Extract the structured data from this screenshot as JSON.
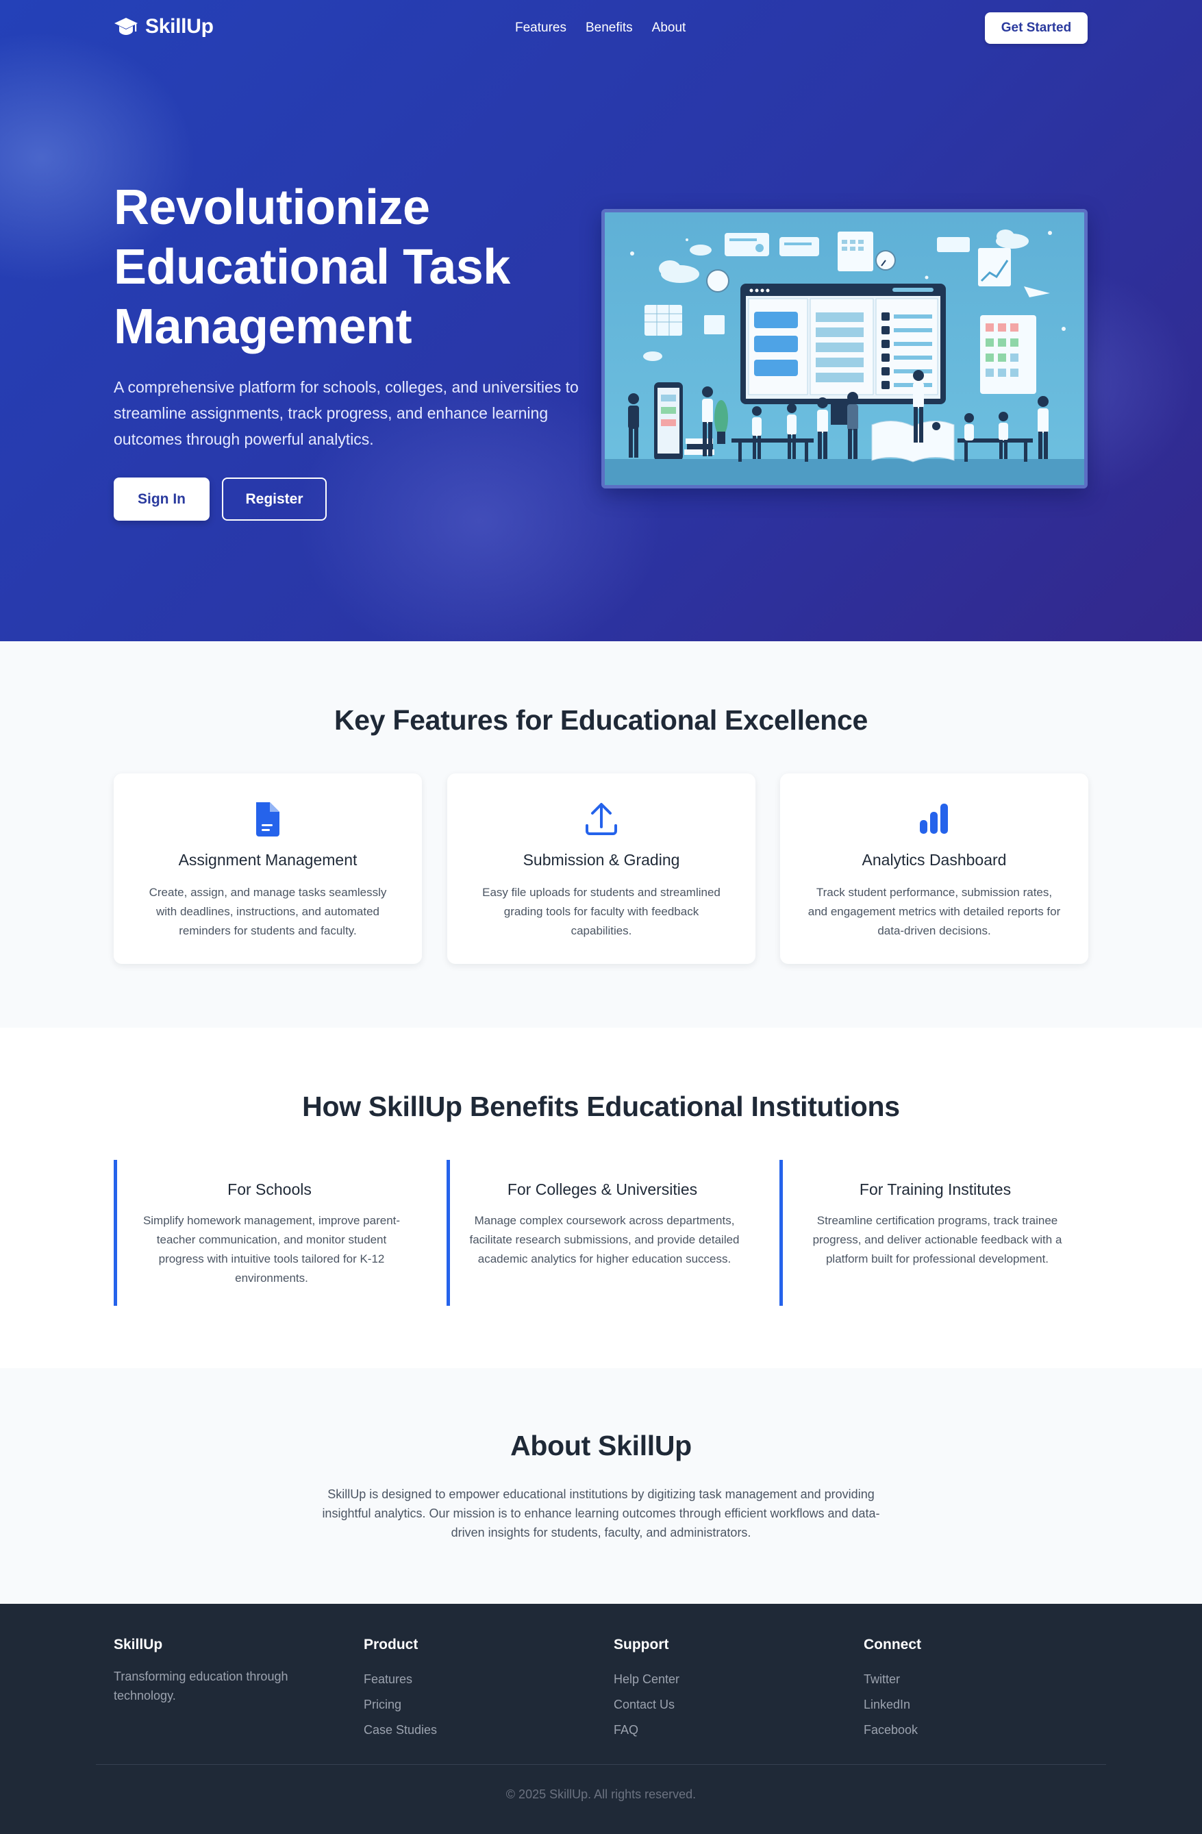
{
  "brand": {
    "name": "SkillUp",
    "accent": "#2563eb",
    "hero_gradient_start": "#2441b8",
    "hero_gradient_end": "#33288c",
    "logo_icon": "graduation-cap-icon"
  },
  "nav": {
    "links": [
      "Features",
      "Benefits",
      "About"
    ],
    "cta": "Get Started"
  },
  "hero": {
    "title": "Revolutionize Educational Task Management",
    "subtitle": "A comprehensive platform for schools, colleges, and universities to streamline assignments, track progress, and enhance learning outcomes through powerful analytics.",
    "signin_label": "Sign In",
    "register_label": "Register"
  },
  "features": {
    "title": "Key Features for Educational Excellence",
    "items": [
      {
        "icon": "document-icon",
        "title": "Assignment Management",
        "text": "Create, assign, and manage tasks seamlessly with deadlines, instructions, and automated reminders for students and faculty."
      },
      {
        "icon": "upload-icon",
        "title": "Submission & Grading",
        "text": "Easy file uploads for students and streamlined grading tools for faculty with feedback capabilities."
      },
      {
        "icon": "bar-chart-icon",
        "title": "Analytics Dashboard",
        "text": "Track student performance, submission rates, and engagement metrics with detailed reports for data-driven decisions."
      }
    ]
  },
  "benefits": {
    "title": "How SkillUp Benefits Educational Institutions",
    "items": [
      {
        "title": "For Schools",
        "text": "Simplify homework management, improve parent-teacher communication, and monitor student progress with intuitive tools tailored for K-12 environments."
      },
      {
        "title": "For Colleges & Universities",
        "text": "Manage complex coursework across departments, facilitate research submissions, and provide detailed academic analytics for higher education success."
      },
      {
        "title": "For Training Institutes",
        "text": "Streamline certification programs, track trainee progress, and deliver actionable feedback with a platform built for professional development."
      }
    ]
  },
  "about": {
    "title": "About SkillUp",
    "text": "SkillUp is designed to empower educational institutions by digitizing task management and providing insightful analytics. Our mission is to enhance learning outcomes through efficient workflows and data-driven insights for students, faculty, and administrators."
  },
  "footer": {
    "brand": "SkillUp",
    "tagline": "Transforming education through technology.",
    "columns": [
      {
        "title": "Product",
        "links": [
          "Features",
          "Pricing",
          "Case Studies"
        ]
      },
      {
        "title": "Support",
        "links": [
          "Help Center",
          "Contact Us",
          "FAQ"
        ]
      },
      {
        "title": "Connect",
        "links": [
          "Twitter",
          "LinkedIn",
          "Facebook"
        ]
      }
    ],
    "copyright": "© 2025 SkillUp. All rights reserved."
  }
}
